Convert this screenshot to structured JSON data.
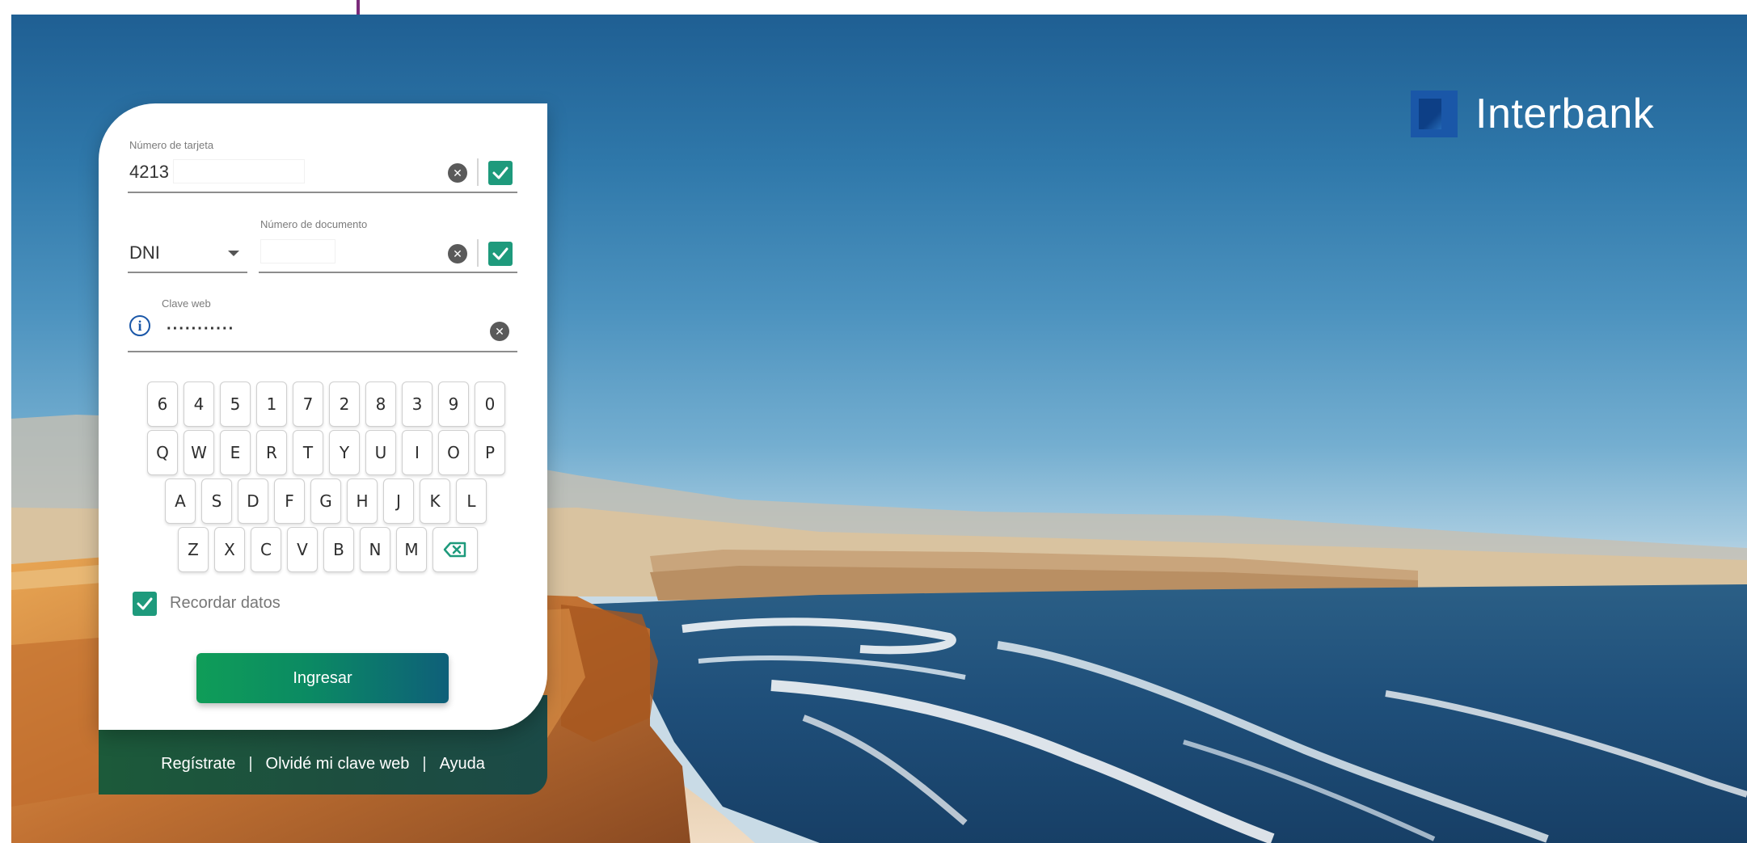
{
  "brand": {
    "name": "Interbank",
    "colors": {
      "accent_green": "#1e9a7c",
      "brand_blue": "#1a57a8",
      "button_gradient_start": "#0f9d58",
      "button_gradient_end": "#0e5f79",
      "footer_green": "#1c5a3a"
    }
  },
  "login_form": {
    "card_number": {
      "label": "Número de tarjeta",
      "value": "4213",
      "clear_icon": "x-circle-icon",
      "status_icon": "check-icon"
    },
    "document": {
      "type_value": "DNI",
      "number_label": "Número de documento",
      "number_value": "",
      "clear_icon": "x-circle-icon",
      "status_icon": "check-icon"
    },
    "web_key": {
      "label": "Clave web",
      "value": "···········",
      "info_icon_glyph": "i",
      "clear_icon": "x-circle-icon"
    },
    "keyboard": {
      "rows": [
        [
          "6",
          "4",
          "5",
          "1",
          "7",
          "2",
          "8",
          "3",
          "9",
          "0"
        ],
        [
          "Q",
          "W",
          "E",
          "R",
          "T",
          "Y",
          "U",
          "I",
          "O",
          "P"
        ],
        [
          "A",
          "S",
          "D",
          "F",
          "G",
          "H",
          "J",
          "K",
          "L"
        ],
        [
          "Z",
          "X",
          "C",
          "V",
          "B",
          "N",
          "M"
        ]
      ],
      "backspace_icon": "backspace-icon"
    },
    "remember": {
      "label": "Recordar datos",
      "checked": true
    },
    "submit_label": "Ingresar"
  },
  "footer": {
    "links": [
      "Regístrate",
      "Olvidé mi clave web",
      "Ayuda"
    ],
    "separator": "|"
  }
}
